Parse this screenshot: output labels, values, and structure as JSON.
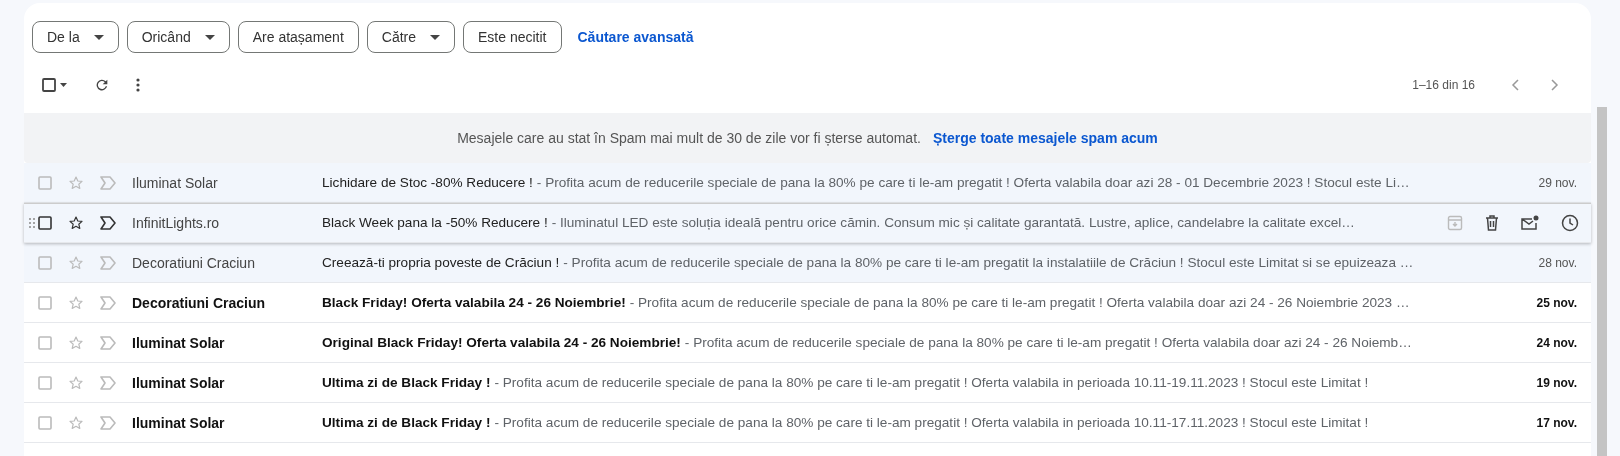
{
  "filters": [
    {
      "label": "De la",
      "dropdown": true
    },
    {
      "label": "Oricând",
      "dropdown": true
    },
    {
      "label": "Are atașament",
      "dropdown": false
    },
    {
      "label": "Către",
      "dropdown": true
    },
    {
      "label": "Este necitit",
      "dropdown": false
    }
  ],
  "advanced_search": "Căutare avansată",
  "select_all": {
    "checked": false
  },
  "pagination": "1–16 din 16",
  "banner": {
    "text": "Mesajele care au stat în Spam mai mult de 30 de zile vor fi șterse automat.",
    "link": "Șterge toate mesajele spam acum"
  },
  "messages": [
    {
      "sender": "Iluminat Solar",
      "subject": "Lichidare de Stoc -80% Reducere !",
      "snippet": "- Profita acum de reducerile speciale de pana la 80% pe care ti le-am pregatit ! Oferta valabila doar azi 28 - 01 Decembrie 2023 ! Stocul este Li…",
      "date": "29 nov.",
      "read": true,
      "hovered": false
    },
    {
      "sender": "InfinitLights.ro",
      "subject": "Black Week pana la -50% Reducere !",
      "snippet": "- Iluminatul LED este soluția ideală pentru orice cămin. Consum mic și calitate garantată. Lustre, aplice, candelabre la calitate excel…",
      "read": true,
      "hovered": true
    },
    {
      "sender": "Decoratiuni Craciun",
      "subject": "Creează-ti propria poveste de Crăciun !",
      "snippet": "- Profita acum de reducerile speciale de pana la 80% pe care ti le-am pregatit la instalatiile de Crăciun ! Stocul este Limitat si se epuizeaza …",
      "date": "28 nov.",
      "read": true,
      "hovered": false
    },
    {
      "sender": "Decoratiuni Craciun",
      "subject": "Black Friday! Oferta valabila 24 - 26 Noiembrie!",
      "snippet": "- Profita acum de reducerile speciale de pana la 80% pe care ti le-am pregatit ! Oferta valabila doar azi 24 - 26 Noiembrie 2023 …",
      "date": "25 nov.",
      "read": false,
      "hovered": false
    },
    {
      "sender": "Iluminat Solar",
      "subject": "Original Black Friday! Oferta valabila 24 - 26 Noiembrie!",
      "snippet": "- Profita acum de reducerile speciale de pana la 80% pe care ti le-am pregatit ! Oferta valabila doar azi 24 - 26 Noiemb…",
      "date": "24 nov.",
      "read": false,
      "hovered": false
    },
    {
      "sender": "Iluminat Solar",
      "subject": "Ultima zi de Black Friday !",
      "snippet": "- Profita acum de reducerile speciale de pana la 80% pe care ti le-am pregatit ! Oferta valabila in perioada 10.11-19.11.2023 ! Stocul este Limitat !",
      "date": "19 nov.",
      "read": false,
      "hovered": false
    },
    {
      "sender": "Iluminat Solar",
      "subject": "Ultima zi de Black Friday !",
      "snippet": "- Profita acum de reducerile speciale de pana la 80% pe care ti le-am pregatit ! Oferta valabila in perioada 10.11-17.11.2023 ! Stocul este Limitat !",
      "date": "17 nov.",
      "read": false,
      "hovered": false
    }
  ]
}
